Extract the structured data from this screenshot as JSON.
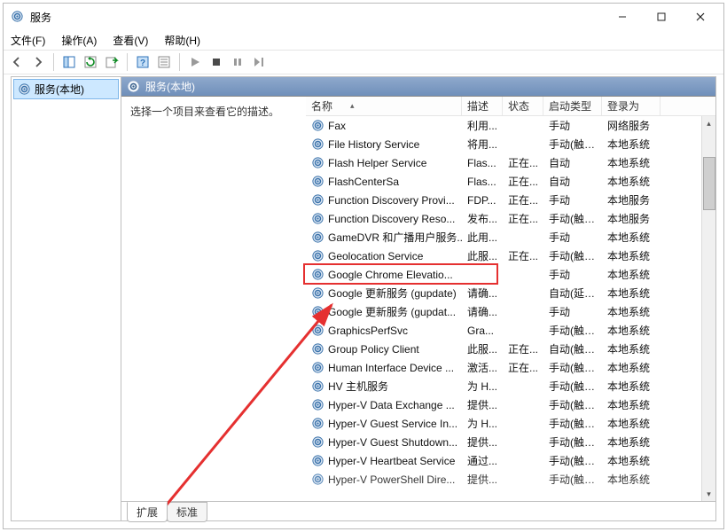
{
  "window": {
    "title": "服务"
  },
  "menu": {
    "file": "文件(F)",
    "action": "操作(A)",
    "view": "查看(V)",
    "help": "帮助(H)"
  },
  "tree": {
    "root": "服务(本地)"
  },
  "pane": {
    "header": "服务(本地)",
    "description_hint": "选择一个项目来查看它的描述。",
    "tab_extended": "扩展",
    "tab_standard": "标准"
  },
  "columns": {
    "name": "名称",
    "description": "描述",
    "status": "状态",
    "startup": "启动类型",
    "logon": "登录为"
  },
  "services": [
    {
      "name": "Fax",
      "desc": "利用...",
      "status": "",
      "startup": "手动",
      "logon": "网络服务"
    },
    {
      "name": "File History Service",
      "desc": "将用...",
      "status": "",
      "startup": "手动(触发...",
      "logon": "本地系统"
    },
    {
      "name": "Flash Helper Service",
      "desc": "Flas...",
      "status": "正在...",
      "startup": "自动",
      "logon": "本地系统"
    },
    {
      "name": "FlashCenterSa",
      "desc": "Flas...",
      "status": "正在...",
      "startup": "自动",
      "logon": "本地系统"
    },
    {
      "name": "Function Discovery Provi...",
      "desc": "FDP...",
      "status": "正在...",
      "startup": "手动",
      "logon": "本地服务"
    },
    {
      "name": "Function Discovery Reso...",
      "desc": "发布...",
      "status": "正在...",
      "startup": "手动(触发...",
      "logon": "本地服务"
    },
    {
      "name": "GameDVR 和广播用户服务...",
      "desc": "此用...",
      "status": "",
      "startup": "手动",
      "logon": "本地系统"
    },
    {
      "name": "Geolocation Service",
      "desc": "此服...",
      "status": "正在...",
      "startup": "手动(触发...",
      "logon": "本地系统"
    },
    {
      "name": "Google Chrome Elevatio...",
      "desc": "",
      "status": "",
      "startup": "手动",
      "logon": "本地系统"
    },
    {
      "name": "Google 更新服务 (gupdate)",
      "desc": "请确...",
      "status": "",
      "startup": "自动(延迟...",
      "logon": "本地系统"
    },
    {
      "name": "Google 更新服务 (gupdat...",
      "desc": "请确...",
      "status": "",
      "startup": "手动",
      "logon": "本地系统"
    },
    {
      "name": "GraphicsPerfSvc",
      "desc": "Gra...",
      "status": "",
      "startup": "手动(触发...",
      "logon": "本地系统"
    },
    {
      "name": "Group Policy Client",
      "desc": "此服...",
      "status": "正在...",
      "startup": "自动(触发...",
      "logon": "本地系统"
    },
    {
      "name": "Human Interface Device ...",
      "desc": "激活...",
      "status": "正在...",
      "startup": "手动(触发...",
      "logon": "本地系统"
    },
    {
      "name": "HV 主机服务",
      "desc": "为 H...",
      "status": "",
      "startup": "手动(触发...",
      "logon": "本地系统"
    },
    {
      "name": "Hyper-V Data Exchange ...",
      "desc": "提供...",
      "status": "",
      "startup": "手动(触发...",
      "logon": "本地系统"
    },
    {
      "name": "Hyper-V Guest Service In...",
      "desc": "为 H...",
      "status": "",
      "startup": "手动(触发...",
      "logon": "本地系统"
    },
    {
      "name": "Hyper-V Guest Shutdown...",
      "desc": "提供...",
      "status": "",
      "startup": "手动(触发...",
      "logon": "本地系统"
    },
    {
      "name": "Hyper-V Heartbeat Service",
      "desc": "通过...",
      "status": "",
      "startup": "手动(触发...",
      "logon": "本地系统"
    },
    {
      "name": "Hyper-V PowerShell Dire...",
      "desc": "提供...",
      "status": "",
      "startup": "手动(触发...",
      "logon": "本地系统"
    }
  ]
}
